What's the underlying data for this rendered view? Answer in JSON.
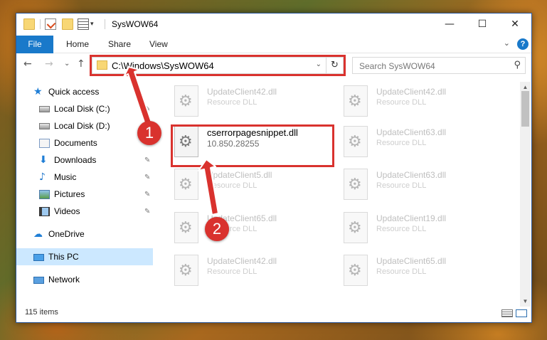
{
  "window": {
    "title": "SysWOW64",
    "minimize_glyph": "—",
    "maximize_glyph": "☐",
    "close_glyph": "✕"
  },
  "ribbon": {
    "tabs": [
      "File",
      "Home",
      "Share",
      "View"
    ],
    "expand_glyph": "⌄",
    "help_glyph": "?"
  },
  "nav": {
    "back_glyph": "←",
    "forward_glyph": "→",
    "recent_glyph": "⌄",
    "up_glyph": "↑",
    "address": "C:\\Windows\\SysWOW64",
    "dropdown_glyph": "⌄",
    "refresh_glyph": "↻",
    "search_placeholder": "Search SysWOW64",
    "search_icon_glyph": "⚲"
  },
  "sidebar": {
    "items": [
      {
        "label": "Quick access",
        "icon": "star-icon",
        "pinned": false
      },
      {
        "label": "Local Disk (C:)",
        "icon": "drive-icon",
        "pinned": true
      },
      {
        "label": "Local Disk (D:)",
        "icon": "drive-icon",
        "pinned": false
      },
      {
        "label": "Documents",
        "icon": "documents-icon",
        "pinned": true
      },
      {
        "label": "Downloads",
        "icon": "download-icon",
        "pinned": true
      },
      {
        "label": "Music",
        "icon": "music-icon",
        "pinned": true
      },
      {
        "label": "Pictures",
        "icon": "pictures-icon",
        "pinned": true
      },
      {
        "label": "Videos",
        "icon": "videos-icon",
        "pinned": true
      },
      {
        "label": "OneDrive",
        "icon": "cloud-icon",
        "pinned": false
      },
      {
        "label": "This PC",
        "icon": "computer-icon",
        "pinned": false,
        "selected": true
      },
      {
        "label": "Network",
        "icon": "network-icon",
        "pinned": false
      }
    ],
    "pin_glyph": "📌"
  },
  "files": [
    {
      "name": "UpdateClient42.dll",
      "type": "Resource DLL"
    },
    {
      "name": "UpdateClient42.dll",
      "type": "Resource DLL"
    },
    {
      "name": "cserrorpagesnippet.dll",
      "type": "10.850.28255",
      "selected": true
    },
    {
      "name": "UpdateClient63.dll",
      "type": "Resource DLL"
    },
    {
      "name": "UpdateClient5.dll",
      "type": "Resource DLL"
    },
    {
      "name": "UpdateClient63.dll",
      "type": "Resource DLL"
    },
    {
      "name": "UpdateClient65.dll",
      "type": "Resource DLL"
    },
    {
      "name": "UpdateClient19.dll",
      "type": "Resource DLL"
    },
    {
      "name": "UpdateClient42.dll",
      "type": "Resource DLL"
    },
    {
      "name": "UpdateClient65.dll",
      "type": "Resource DLL"
    }
  ],
  "status": {
    "item_count": "115 items"
  },
  "annotations": {
    "step1": "1",
    "step2": "2",
    "highlight_color": "#d9322e"
  },
  "scrollbar": {
    "up_glyph": "▲",
    "down_glyph": "▼"
  }
}
